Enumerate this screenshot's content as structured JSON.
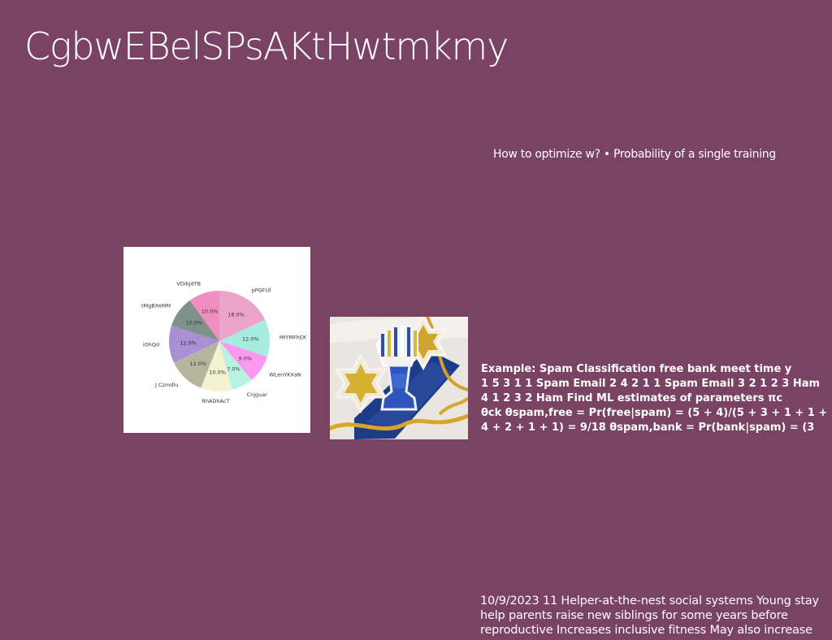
{
  "slide": {
    "title": "CgbwEBelSPsAKtHwtmkmy",
    "subtitle": "How to optimize w? • Probability of a single training",
    "bold_text": "Example: Spam Classification free bank meet time y\n1 5 3 1 1 Spam Email 2 4 2 1 1 Spam Email 3 2 1 2 3 Ham\n4 1 2 3 2 Ham Find ML estimates of parameters πc\nθck θspam,free = Pr(free|spam) = (5 + 4)/(5 + 3 + 1 + 1 +\n4 + 2 + 1 + 1) = 9/18 θspam,bank = Pr(bank|spam) = (3",
    "footer_text": "10/9/2023 11 Helper-at-the-nest social systems Young stay\nhelp parents raise new siblings for some years before\nreproductive Increases inclusive fitness May also increase",
    "background": "#7a4363"
  },
  "chart_data": {
    "type": "pie",
    "categories": [
      "pPGFUf",
      "MIYMFhEK",
      "WLenYKXaN",
      "Cnjguar",
      "RhADhAcT",
      "J Czmdlu",
      "iOhQd",
      "tMgBXeMM",
      "VDibjdTB"
    ],
    "values": [
      18.0,
      12.0,
      9.0,
      7.0,
      10.0,
      12.0,
      12.0,
      10.0,
      10.0
    ],
    "labels": [
      "18.0%",
      "12.0%",
      "9.0%",
      "7.0%",
      "10.0%",
      "12.0%",
      "12.0%",
      "10.0%",
      "10.0%"
    ],
    "colors": [
      "#eca5c9",
      "#a6ecde",
      "#fb99f1",
      "#b8f2e2",
      "#f5f1d3",
      "#b6b49c",
      "#a98fd3",
      "#7f9189",
      "#f08ec2"
    ],
    "start_position": "top",
    "direction": "clockwise"
  }
}
